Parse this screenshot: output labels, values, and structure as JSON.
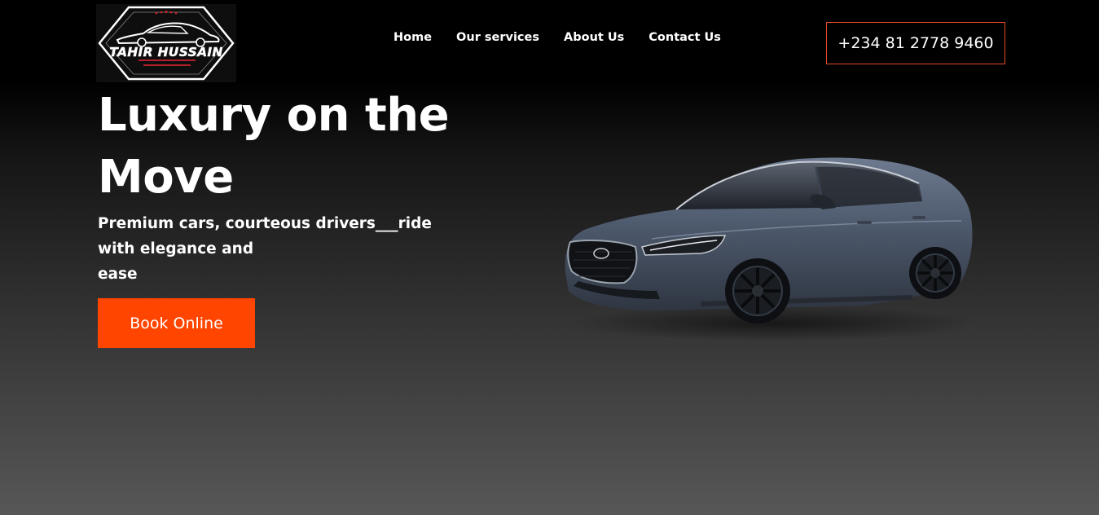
{
  "brand": {
    "logo_line1": "TAHIR HUSSAIN",
    "logo_line2": "CHAUFFEUR SERVICES"
  },
  "nav": {
    "items": [
      {
        "label": "Home"
      },
      {
        "label": "Our services"
      },
      {
        "label": "About Us"
      },
      {
        "label": "Contact Us"
      }
    ]
  },
  "header": {
    "phone_label": "+234 81 2778 9460"
  },
  "hero": {
    "title": "Luxury on the Move",
    "subtitle": "Premium cars, courteous drivers___ride with elegance and\nease",
    "cta_label": "Book Online",
    "image": "car-sedan-image"
  },
  "colors": {
    "accent": "#ff4500",
    "phone_border": "#e8492a",
    "car_body": "#4a5568"
  }
}
